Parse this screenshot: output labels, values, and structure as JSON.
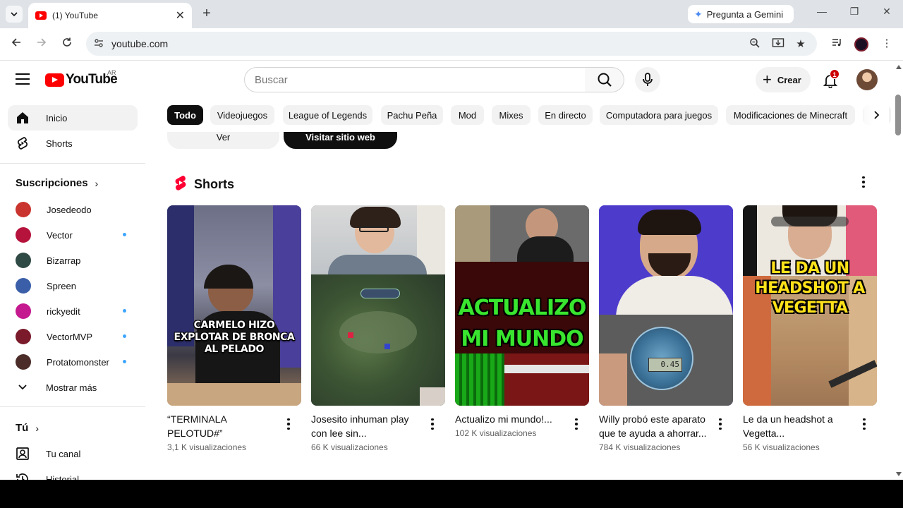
{
  "browser": {
    "tab_title": "(1) YouTube",
    "new_tab": "+",
    "gemini_label": "Pregunta a Gemini",
    "url": "youtube.com"
  },
  "header": {
    "logo_text": "YouTube",
    "region": "AR",
    "search_placeholder": "Buscar",
    "create_label": "Crear",
    "notification_count": "1"
  },
  "sidebar": {
    "main": [
      {
        "label": "Inicio",
        "icon": "home-icon"
      },
      {
        "label": "Shorts",
        "icon": "shorts-icon"
      }
    ],
    "subscriptions_heading": "Suscripciones",
    "subscriptions": [
      {
        "label": "Josedeodo",
        "color": "#c9342e",
        "live": false
      },
      {
        "label": "Vector",
        "color": "#b5123c",
        "live": true
      },
      {
        "label": "Bizarrap",
        "color": "#2f4a45",
        "live": false
      },
      {
        "label": "Spreen",
        "color": "#3a5fa8",
        "live": false
      },
      {
        "label": "rickyedit",
        "color": "#c4198f",
        "live": true
      },
      {
        "label": "VectorMVP",
        "color": "#7a1a2a",
        "live": true
      },
      {
        "label": "Protatomonster",
        "color": "#4b2c28",
        "live": true
      }
    ],
    "show_more": "Mostrar más",
    "you_heading": "Tú",
    "you_items": [
      {
        "label": "Tu canal",
        "icon": "channel-icon"
      },
      {
        "label": "Historial",
        "icon": "history-icon"
      }
    ]
  },
  "chips": [
    "Todo",
    "Videojuegos",
    "League of Legends",
    "Pachu Peña",
    "Mod",
    "Mixes",
    "En directo",
    "Computadora para juegos",
    "Modificaciones de Minecraft"
  ],
  "ad": {
    "secondary_label": "Ver",
    "primary_label": "Visitar sitio web"
  },
  "shorts": {
    "heading": "Shorts",
    "items": [
      {
        "title": "“TERMINALA PELOTUD#”",
        "views": "3,1 K visualizaciones",
        "overlay": "CARMELO hizo EXPLOTAR DE BRONCA al PELADO"
      },
      {
        "title": "Josesito inhuman play con lee sin...",
        "views": "66 K visualizaciones",
        "overlay": ""
      },
      {
        "title": "Actualizo mi mundo!...",
        "views": "102 K visualizaciones",
        "overlay": "ACTUALIZO MI MUNDO"
      },
      {
        "title": "Willy probó este aparato que te ayuda a ahorrar...",
        "views": "784 K visualizaciones",
        "overlay": "",
        "device_reading": "0.45"
      },
      {
        "title": "Le da un headshot a Vegetta...",
        "views": "56 K visualizaciones",
        "overlay": "LE DA UN HEADSHOT A VEGETTA"
      }
    ]
  }
}
